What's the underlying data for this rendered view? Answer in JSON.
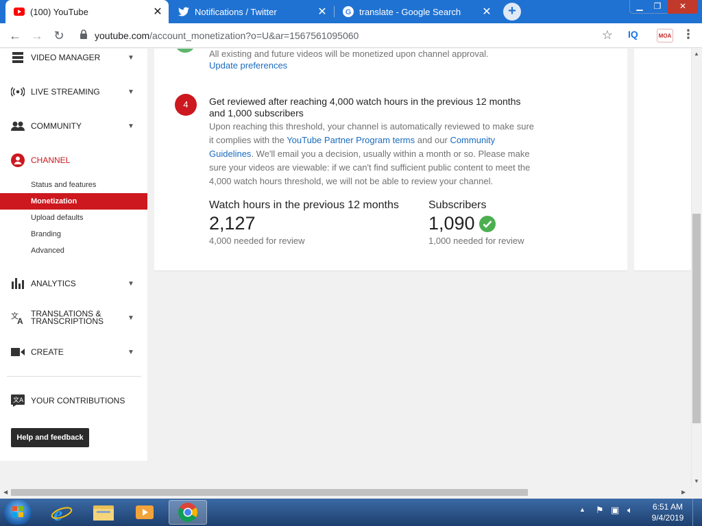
{
  "browser": {
    "tabs": [
      {
        "title": "(100) YouTube",
        "active": true
      },
      {
        "title": "Notifications / Twitter",
        "active": false
      },
      {
        "title": "translate - Google Search",
        "active": false
      }
    ],
    "url_host": "youtube.com",
    "url_path": "/account_monetization?o=U&ar=1567561095060",
    "extensions": {
      "iq": "IQ",
      "moa": "MOA"
    }
  },
  "sidebar": {
    "items": [
      {
        "label": "VIDEO MANAGER",
        "icon": "video-manager-icon"
      },
      {
        "label": "LIVE STREAMING",
        "icon": "live-streaming-icon"
      },
      {
        "label": "COMMUNITY",
        "icon": "community-icon"
      },
      {
        "label": "CHANNEL",
        "icon": "channel-icon"
      },
      {
        "label": "ANALYTICS",
        "icon": "analytics-icon"
      },
      {
        "label": "TRANSLATIONS & TRANSCRIPTIONS",
        "icon": "translate-icon"
      },
      {
        "label": "CREATE",
        "icon": "create-icon"
      },
      {
        "label": "YOUR CONTRIBUTIONS",
        "icon": "contributions-icon"
      }
    ],
    "channel_sub": [
      {
        "label": "Status and features"
      },
      {
        "label": "Monetization"
      },
      {
        "label": "Upload defaults"
      },
      {
        "label": "Branding"
      },
      {
        "label": "Advanced"
      }
    ],
    "help_button": "Help and feedback"
  },
  "main": {
    "prev_step_text": "All existing and future videos will be monetized upon channel approval.",
    "prev_step_link": "Update preferences",
    "step_number": "4",
    "step_title": "Get reviewed after reaching 4,000 watch hours in the previous 12 months and 1,000 subscribers",
    "desc_1": "Upon reaching this threshold, your channel is automatically reviewed to make sure it complies with the ",
    "desc_link_1": "YouTube Partner Program terms",
    "desc_2": " and our ",
    "desc_link_2": "Community Guidelines",
    "desc_3": ". We'll email you a decision, usually within a month or so. Please make sure your videos are viewable: if we can't find sufficient public content to meet the 4,000 watch hours threshold, we will not be able to review your channel.",
    "watch_hours": {
      "label": "Watch hours in the previous 12 months",
      "value": "2,127",
      "note": "4,000 needed for review"
    },
    "subscribers": {
      "label": "Subscribers",
      "value": "1,090",
      "note": "1,000 needed for review"
    }
  },
  "taskbar": {
    "time": "6:51 AM",
    "date": "9/4/2019"
  },
  "colors": {
    "accent": "#cc181e",
    "link": "#1a6bbf",
    "success": "#4caf50",
    "chrome_frame": "#1f72d2"
  }
}
